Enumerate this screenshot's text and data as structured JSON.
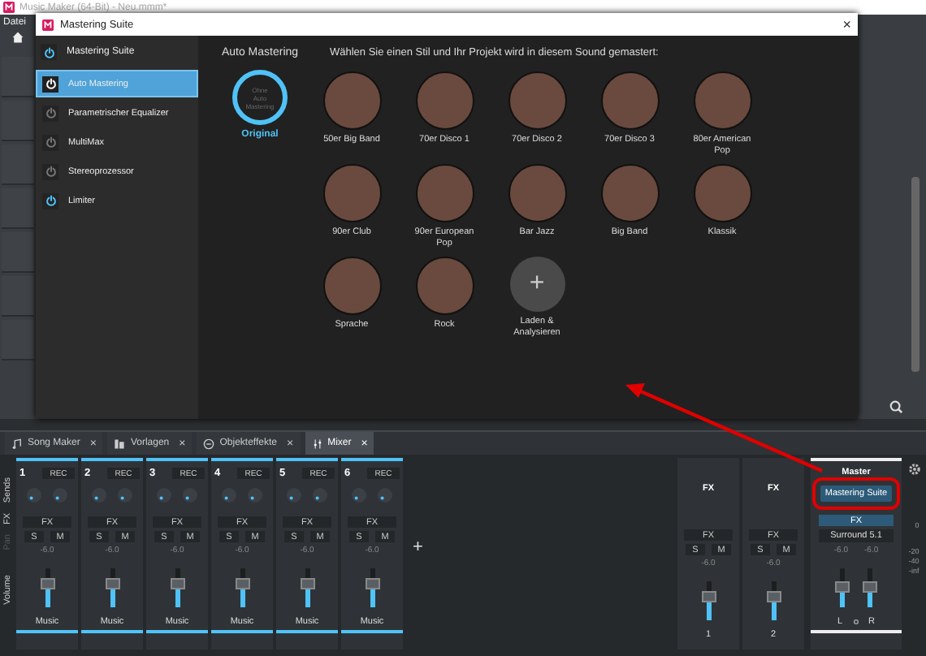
{
  "app_window": {
    "title": "Music Maker (64-Bit) - Neu.mmm*",
    "menu": [
      "Datei"
    ]
  },
  "dialog": {
    "title": "Mastering Suite",
    "close": "×",
    "sidebar": {
      "header": {
        "label": "Mastering Suite",
        "on": true
      },
      "items": [
        {
          "label": "Auto Mastering",
          "selected": true,
          "on": true
        },
        {
          "label": "Parametrischer Equalizer",
          "selected": false,
          "on": false
        },
        {
          "label": "MultiMax",
          "selected": false,
          "on": false
        },
        {
          "label": "Stereoprozessor",
          "selected": false,
          "on": false
        },
        {
          "label": "Limiter",
          "selected": false,
          "on": true
        }
      ]
    },
    "content": {
      "title": "Auto Mastering",
      "instruction": "Wählen Sie einen Stil und Ihr Projekt wird in diesem Sound gemastert:",
      "original": {
        "ring_text": "Ohne Auto Mastering",
        "label": "Original",
        "selected": true
      },
      "presets": [
        {
          "kind": "style",
          "label": "50er Big Band"
        },
        {
          "kind": "style",
          "label": "70er Disco 1"
        },
        {
          "kind": "style",
          "label": "70er Disco 2"
        },
        {
          "kind": "style",
          "label": "70er Disco 3"
        },
        {
          "kind": "style",
          "label": "80er American Pop"
        },
        {
          "kind": "style",
          "label": "90er Club"
        },
        {
          "kind": "style",
          "label": "90er European Pop"
        },
        {
          "kind": "style",
          "label": "Bar Jazz"
        },
        {
          "kind": "style",
          "label": "Big Band"
        },
        {
          "kind": "style",
          "label": "Klassik"
        },
        {
          "kind": "style",
          "label": "Sprache"
        },
        {
          "kind": "style",
          "label": "Rock"
        },
        {
          "kind": "add",
          "label": "Laden & Analysieren",
          "icon": "+"
        }
      ]
    }
  },
  "tabs": [
    {
      "label": "Song Maker",
      "selected": false,
      "close": "×"
    },
    {
      "label": "Vorlagen",
      "selected": false,
      "close": "×"
    },
    {
      "label": "Objekteffekte",
      "selected": false,
      "close": "×"
    },
    {
      "label": "Mixer",
      "selected": true,
      "close": "×"
    }
  ],
  "mixer": {
    "row_labels": [
      {
        "label": "Sends",
        "disabled": false
      },
      {
        "label": "FX",
        "disabled": false
      },
      {
        "label": "Pan",
        "disabled": true
      },
      {
        "label": "Volume",
        "disabled": false
      }
    ],
    "channels": [
      {
        "number": "1",
        "rec": "REC",
        "fx": "FX",
        "solo": "S",
        "mute": "M",
        "gain": "-6.0",
        "level": 0.6,
        "name": "Music"
      },
      {
        "number": "2",
        "rec": "REC",
        "fx": "FX",
        "solo": "S",
        "mute": "M",
        "gain": "-6.0",
        "level": 0.6,
        "name": "Music"
      },
      {
        "number": "3",
        "rec": "REC",
        "fx": "FX",
        "solo": "S",
        "mute": "M",
        "gain": "-6.0",
        "level": 0.6,
        "name": "Music"
      },
      {
        "number": "4",
        "rec": "REC",
        "fx": "FX",
        "solo": "S",
        "mute": "M",
        "gain": "-6.0",
        "level": 0.6,
        "name": "Music"
      },
      {
        "number": "5",
        "rec": "REC",
        "fx": "FX",
        "solo": "S",
        "mute": "M",
        "gain": "-6.0",
        "level": 0.6,
        "name": "Music"
      },
      {
        "number": "6",
        "rec": "REC",
        "fx": "FX",
        "solo": "S",
        "mute": "M",
        "gain": "-6.0",
        "level": 0.6,
        "name": "Music"
      }
    ],
    "add": "+",
    "fx_channels": [
      {
        "title": "FX",
        "fx": "FX",
        "solo": "S",
        "mute": "M",
        "gain": "-6.0",
        "level": 0.6,
        "name": "1"
      },
      {
        "title": "FX",
        "fx": "FX",
        "solo": "S",
        "mute": "M",
        "gain": "-6.0",
        "level": 0.6,
        "name": "2"
      }
    ],
    "master": {
      "title": "Master",
      "plugin_button": "Mastering Suite",
      "highlighted": true,
      "fx": "FX",
      "fx_active": true,
      "output": "Surround 5.1",
      "faders": [
        {
          "gain": "-6.0",
          "level": 0.5,
          "label": "L"
        },
        {
          "gain": "-6.0",
          "level": 0.5,
          "label": "R"
        }
      ]
    },
    "meter_scale": [
      "0",
      "-20",
      "-40",
      "-inf"
    ]
  }
}
